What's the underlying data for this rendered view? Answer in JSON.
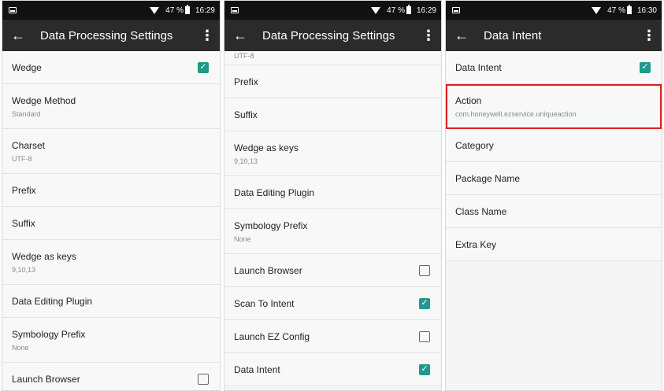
{
  "status": {
    "battery": "47 %",
    "times": [
      "16:29",
      "16:29",
      "16:30"
    ]
  },
  "panel1": {
    "title": "Data Processing Settings",
    "items": [
      {
        "label": "Wedge",
        "checked": true
      },
      {
        "label": "Wedge Method",
        "value": "Standard"
      },
      {
        "label": "Charset",
        "value": "UTF-8"
      },
      {
        "label": "Prefix"
      },
      {
        "label": "Suffix"
      },
      {
        "label": "Wedge as keys",
        "value": "9,10,13"
      },
      {
        "label": "Data Editing Plugin"
      },
      {
        "label": "Symbology Prefix",
        "value": "None"
      },
      {
        "label": "Launch Browser",
        "checked": false
      }
    ]
  },
  "panel2": {
    "title": "Data Processing Settings",
    "partial_value": "UTF-8",
    "items": [
      {
        "label": "Prefix"
      },
      {
        "label": "Suffix"
      },
      {
        "label": "Wedge as keys",
        "value": "9,10,13"
      },
      {
        "label": "Data Editing Plugin"
      },
      {
        "label": "Symbology Prefix",
        "value": "None"
      },
      {
        "label": "Launch Browser",
        "checked": false
      },
      {
        "label": "Scan To Intent",
        "checked": true
      },
      {
        "label": "Launch EZ Config",
        "checked": false
      },
      {
        "label": "Data Intent",
        "checked": true
      }
    ]
  },
  "panel3": {
    "title": "Data Intent",
    "items": [
      {
        "label": "Data Intent",
        "checked": true
      },
      {
        "label": "Action",
        "value": "com.honeywell.ezservice.uniqueaction"
      },
      {
        "label": "Category"
      },
      {
        "label": "Package Name"
      },
      {
        "label": "Class Name"
      },
      {
        "label": "Extra Key"
      }
    ]
  },
  "icons": {
    "back": "arrow-back-icon",
    "more": "more-vert-icon",
    "check": "checkmark-icon"
  },
  "colors": {
    "accent": "#1e9a8c",
    "highlight": "#e02020",
    "appbar": "#2b2b2b"
  }
}
